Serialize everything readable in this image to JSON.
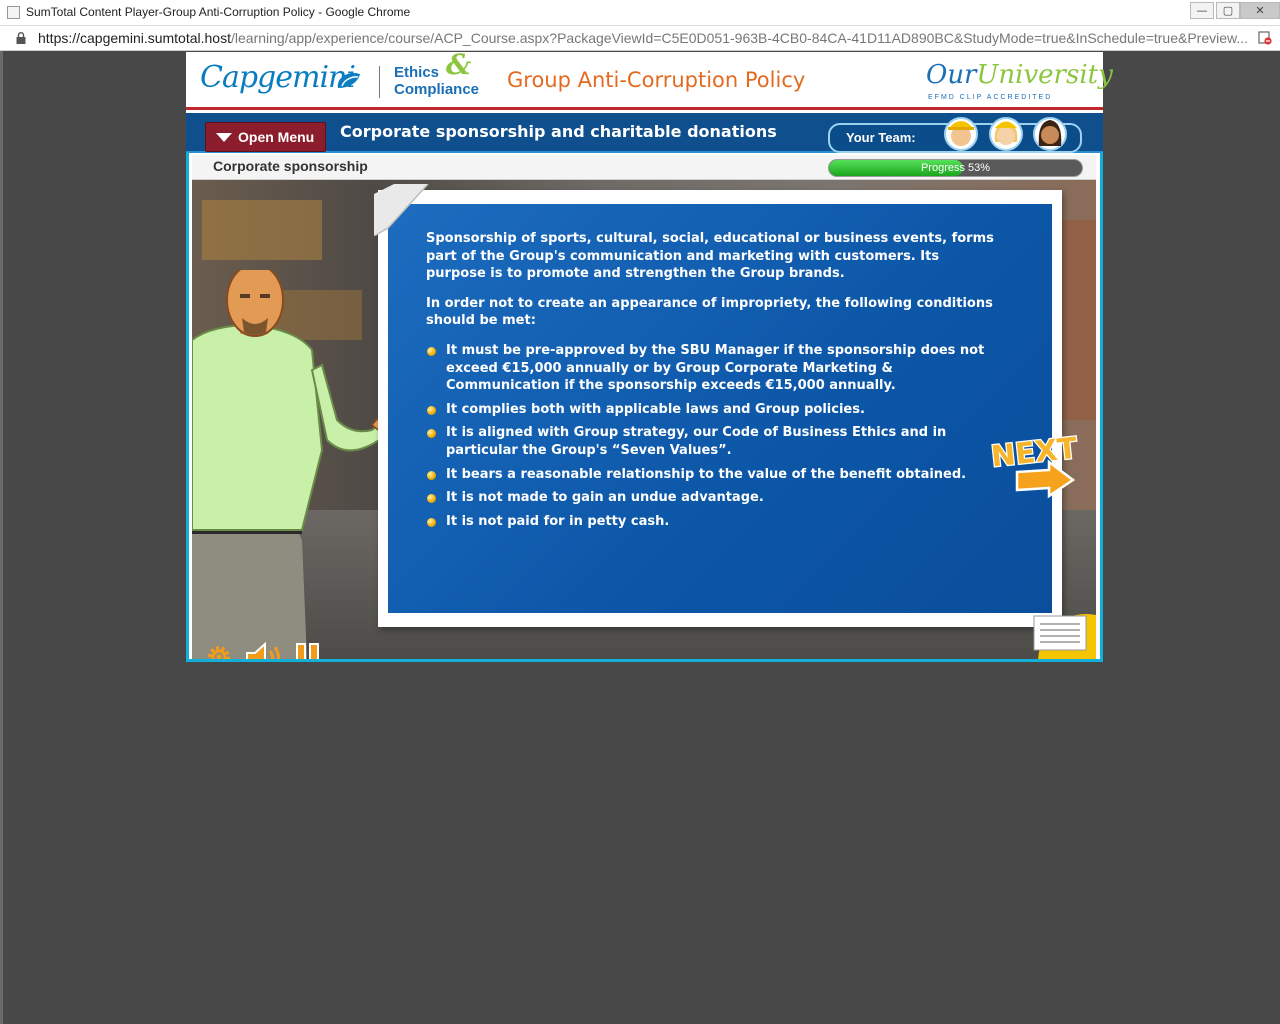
{
  "browser": {
    "window_title": "SumTotal Content Player-Group Anti-Corruption Policy - Google Chrome",
    "url_host": "https://capgemini.sumtotal.host",
    "url_path": "/learning/app/experience/course/ACP_Course.aspx?PackageViewId=C5E0D051-963B-4CB0-84CA-41D11AD890BC&StudyMode=true&InSchedule=true&Preview...",
    "minimize": "—",
    "restore": "▢",
    "close": "✕"
  },
  "brand": {
    "company": "Capgemini",
    "program_line1": "Ethics",
    "program_amp": "&",
    "program_line2": "Compliance",
    "course_title": "Group Anti-Corruption Policy",
    "university_a": "Our",
    "university_b": "University",
    "university_sub": "EFMD CLIP ACCREDITED"
  },
  "nav": {
    "menu_label": "Open Menu",
    "section_title": "Corporate sponsorship and charitable donations",
    "team_label": "Your Team:"
  },
  "subbar": {
    "title": "Corporate sponsorship",
    "progress_text": "Progress 53%",
    "progress_value": 53
  },
  "content": {
    "para1": "Sponsorship of sports, cultural, social, educational or business events, forms part of the Group's communication and marketing with customers. Its purpose is to promote and strengthen the Group brands.",
    "para2": "In order not to create an appearance of impropriety, the following conditions should be met:",
    "bullets": [
      "It must be pre-approved by the SBU Manager if the sponsorship does not exceed €15,000 annually or by Group Corporate Marketing & Communication if the sponsorship exceeds €15,000 annually.",
      "It complies both with applicable laws and Group policies.",
      "It is aligned with Group strategy, our Code of Business Ethics and in particular the Group's “Seven Values”.",
      "It bears a reasonable relationship to the value of the benefit obtained.",
      "It is not made to gain an undue advantage.",
      "It is not paid for in petty cash."
    ]
  },
  "controls": {
    "next_label": "NEXT"
  },
  "colors": {
    "accent_orange": "#e46a1f",
    "brand_blue": "#0a7cc1",
    "nav_blue": "#0f4f8d",
    "menu_red": "#8c1d2c",
    "progress_green": "#1aa51c",
    "frame_cyan": "#12b0d8"
  }
}
